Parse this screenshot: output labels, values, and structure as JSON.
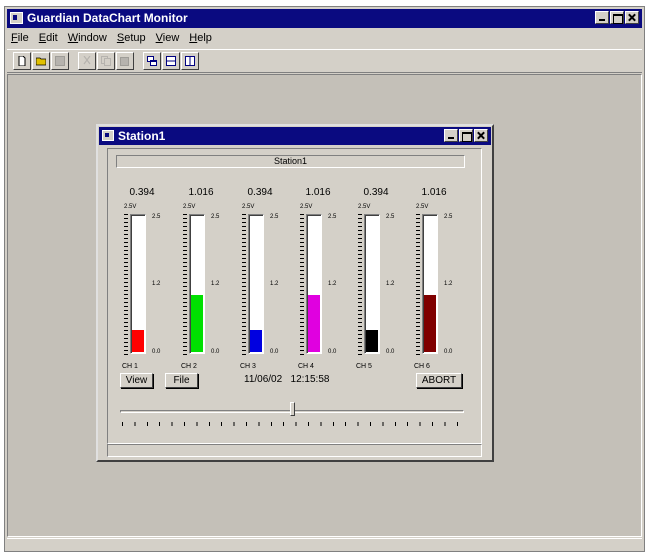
{
  "app": {
    "title": "Guardian DataChart Monitor"
  },
  "menu": [
    {
      "pre": "",
      "ul": "F",
      "post": "ile"
    },
    {
      "pre": "",
      "ul": "E",
      "post": "dit"
    },
    {
      "pre": "",
      "ul": "W",
      "post": "indow"
    },
    {
      "pre": "",
      "ul": "S",
      "post": "etup"
    },
    {
      "pre": "",
      "ul": "V",
      "post": "iew"
    },
    {
      "pre": "",
      "ul": "H",
      "post": "elp"
    }
  ],
  "toolbar": [
    {
      "icon": "new-doc-icon",
      "enabled": true
    },
    {
      "icon": "open-folder-icon",
      "enabled": true
    },
    {
      "icon": "save-icon",
      "enabled": false
    },
    {
      "icon": "cut-icon",
      "enabled": false
    },
    {
      "icon": "copy-icon",
      "enabled": false
    },
    {
      "icon": "paste-icon",
      "enabled": false
    },
    {
      "icon": "cascade-windows-icon",
      "enabled": true
    },
    {
      "icon": "tile-horizontal-icon",
      "enabled": true
    },
    {
      "icon": "tile-vertical-icon",
      "enabled": true
    }
  ],
  "station": {
    "title": "Station1",
    "label": "Station1",
    "channels": [
      {
        "value": "0.394",
        "top": "2.5V",
        "r_top": "2.5",
        "r_mid": "1.2",
        "r_bot": "0.0",
        "name": "CH 1",
        "level": 0.16,
        "color": "#ff0000"
      },
      {
        "value": "1.016",
        "top": "2.5V",
        "r_top": "2.5",
        "r_mid": "1.2",
        "r_bot": "0.0",
        "name": "CH 2",
        "level": 0.41,
        "color": "#00e000"
      },
      {
        "value": "0.394",
        "top": "2.5V",
        "r_top": "2.5",
        "r_mid": "1.2",
        "r_bot": "0.0",
        "name": "CH 3",
        "level": 0.16,
        "color": "#0000e0"
      },
      {
        "value": "1.016",
        "top": "2.5V",
        "r_top": "2.5",
        "r_mid": "1.2",
        "r_bot": "0.0",
        "name": "CH 4",
        "level": 0.41,
        "color": "#e000e0"
      },
      {
        "value": "0.394",
        "top": "2.5V",
        "r_top": "2.5",
        "r_mid": "1.2",
        "r_bot": "0.0",
        "name": "CH 5",
        "level": 0.16,
        "color": "#000000"
      },
      {
        "value": "1.016",
        "top": "2.5V",
        "r_top": "2.5",
        "r_mid": "1.2",
        "r_bot": "0.0",
        "name": "CH 6",
        "level": 0.41,
        "color": "#800000"
      }
    ],
    "buttons": {
      "view": "View",
      "file": "File",
      "abort": "ABORT"
    },
    "date": "11/06/02",
    "time": "12:15:58",
    "slider": {
      "position": 0.5
    }
  }
}
